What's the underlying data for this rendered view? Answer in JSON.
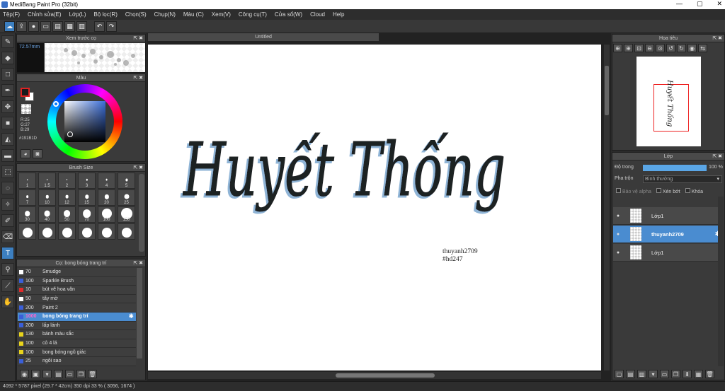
{
  "window": {
    "title": "MediBang Paint Pro (32bit)",
    "controls": [
      "—",
      "▢",
      "✕"
    ]
  },
  "menu": [
    "Tệp(F)",
    "Chỉnh sửa(E)",
    "Lớp(L)",
    "Bộ lọc(R)",
    "Chọn(S)",
    "Chụp(N)",
    "Màu (C)",
    "Xem(V)",
    "Công cụ(T)",
    "Cửa sổ(W)",
    "Cloud",
    "Help"
  ],
  "toolbar": {
    "icons": [
      "cloud-icon",
      "export-icon",
      "speech-bubble-icon",
      "comment-icon",
      "save-icon",
      "film-icon",
      "grid-icon",
      "undo-icon",
      "redo-icon"
    ]
  },
  "tools": [
    "brush-icon",
    "eraser-icon",
    "rectangle-icon",
    "pen-icon",
    "move-icon",
    "fill-rect-icon",
    "bucket-icon",
    "gradient-icon",
    "select-rect-icon",
    "lasso-icon",
    "magic-wand-icon",
    "select-pen-icon",
    "select-eraser-icon",
    "text-icon",
    "divide-icon",
    "eyedropper-icon",
    "hand-icon"
  ],
  "brush_preview": {
    "title": "Xem trước cọ",
    "size": "72.57mm"
  },
  "color_panel": {
    "title": "Màu",
    "r": "R:25",
    "g": "G:27",
    "b": "B:29",
    "hex": "#191B1D",
    "fg_color": "#191b1d"
  },
  "brush_size": {
    "title": "Brush Size",
    "sizes": [
      "1",
      "1.5",
      "2",
      "3",
      "4",
      "5",
      "7",
      "10",
      "12",
      "15",
      "20",
      "25",
      "30",
      "40",
      "50",
      "70",
      "100",
      "150",
      "",
      "",
      "",
      "",
      "",
      ""
    ]
  },
  "brush_list": {
    "title": "Cọ: bong bóng trang trí",
    "items": [
      {
        "size": "70",
        "name": "Smudge",
        "color": "#ffffff"
      },
      {
        "size": "100",
        "name": "Sparkle Brush",
        "color": "#3a5fd8"
      },
      {
        "size": "10",
        "name": "bút vẽ hoa văn",
        "color": "#e02a2a"
      },
      {
        "size": "50",
        "name": "tẩy mờ",
        "color": "#ffffff"
      },
      {
        "size": "200",
        "name": "Paint 2",
        "color": "#3a5fd8"
      },
      {
        "size": "1000",
        "name": "bong bóng trang trí",
        "color": "#3a5fd8"
      },
      {
        "size": "200",
        "name": "lấp lánh",
        "color": "#3a5fd8"
      },
      {
        "size": "130",
        "name": "bánh màu sắc",
        "color": "#e8d31c"
      },
      {
        "size": "100",
        "name": "cỏ 4 lá",
        "color": "#e8d31c"
      },
      {
        "size": "100",
        "name": "bong bóng ngũ giác",
        "color": "#e8d31c"
      },
      {
        "size": "25",
        "name": "ngôi sao",
        "color": "#3a5fd8"
      }
    ]
  },
  "canvas": {
    "tab": "Untitled",
    "artwork_title": "Huyết Thống",
    "signature_line1": "thuyanh2709",
    "signature_line2": "#hd247"
  },
  "navigator": {
    "title": "Hoa tiêu",
    "mini_text": "Huyết Thống"
  },
  "layers": {
    "title": "Lớp",
    "opacity_label": "Độ trong",
    "opacity_value": "100 %",
    "opacity": 1.0,
    "blend_label": "Pha trộn",
    "blend_value": "Bình thường",
    "protect_alpha": "Bảo vệ alpha",
    "clipping": "Xén bớt",
    "lock": "Khóa",
    "items": [
      {
        "name": "Lớp1",
        "selected": false
      },
      {
        "name": "thuyanh2709",
        "selected": true
      },
      {
        "name": "Lớp1",
        "selected": false
      }
    ]
  },
  "status": {
    "text": "4092 * 5787 pixel  (29.7 * 42cm)  350 dpi  33 %  ( 3056, 1674 )"
  }
}
